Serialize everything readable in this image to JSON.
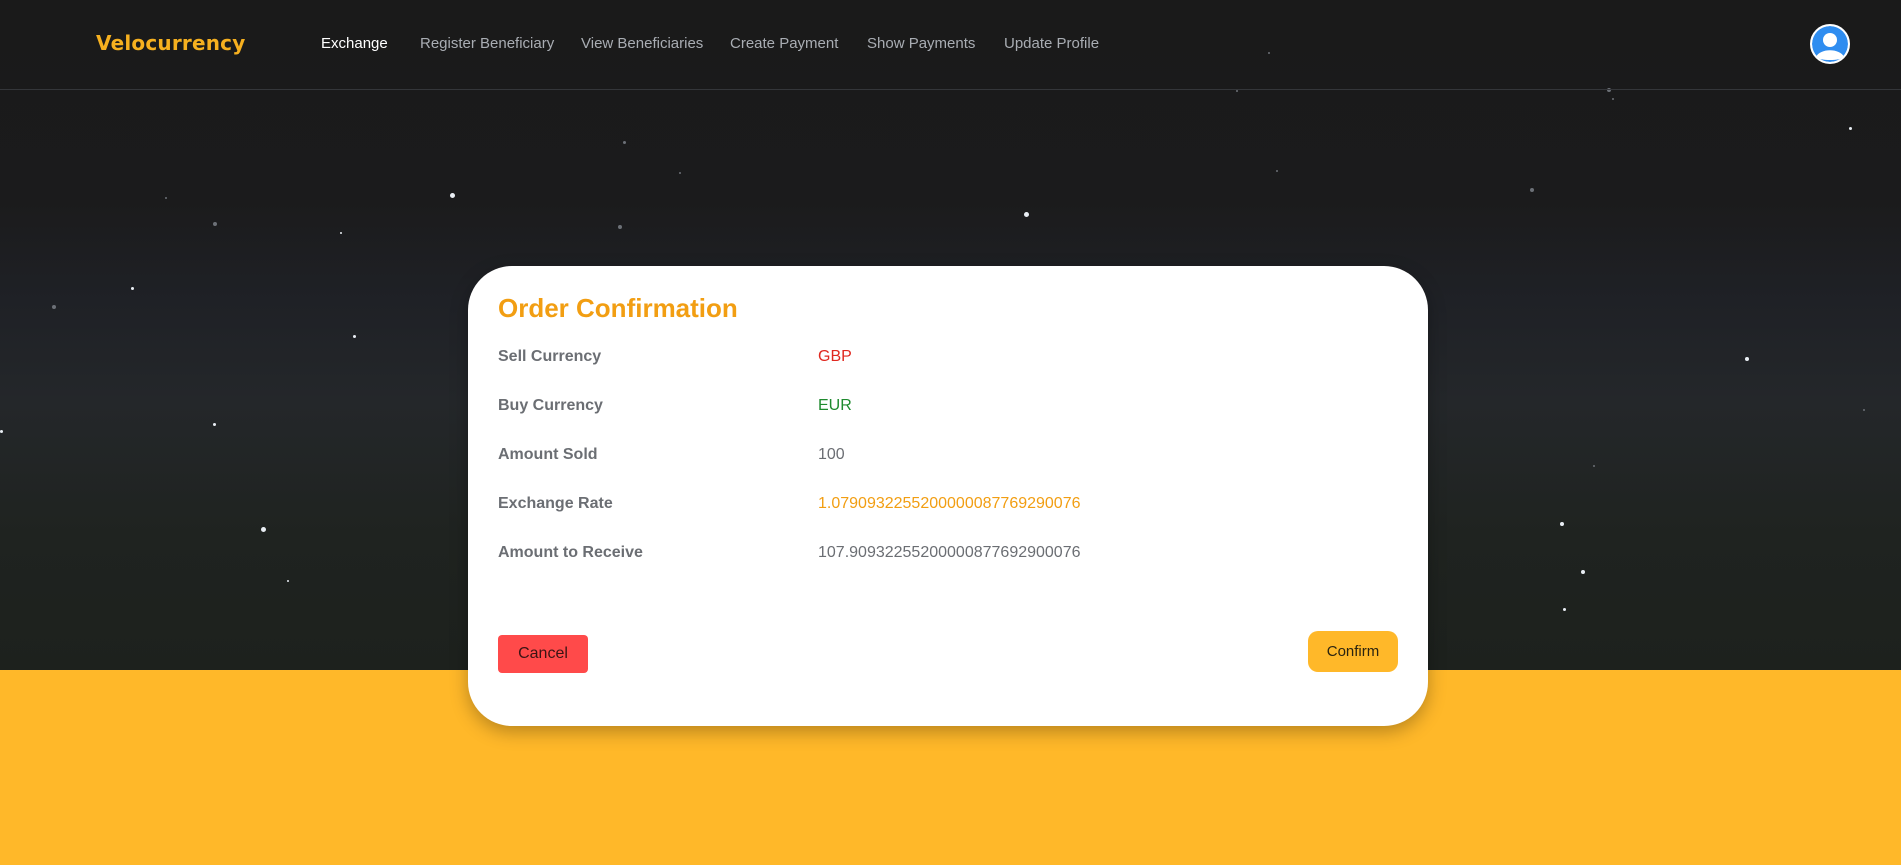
{
  "brand": "Velocurrency",
  "nav": {
    "exchange": "Exchange",
    "register_beneficiary": "Register Beneficiary",
    "view_beneficiaries": "View Beneficiaries",
    "create_payment": "Create Payment",
    "show_payments": "Show Payments",
    "update_profile": "Update Profile",
    "active": "Exchange"
  },
  "profile_icon": "user-avatar-icon",
  "order": {
    "title": "Order Confirmation",
    "rows": [
      {
        "label": "Sell Currency",
        "value": "GBP",
        "color": "#e0281f"
      },
      {
        "label": "Buy Currency",
        "value": "EUR",
        "color": "#1e8a2e"
      },
      {
        "label": "Amount Sold",
        "value": "100",
        "color": "#6b6e73"
      },
      {
        "label": "Exchange Rate",
        "value": "1.0790932255200000087769290076",
        "color": "#f29e12"
      },
      {
        "label": "Amount to Receive",
        "value": "107.90932255200000877692900076",
        "color": "#6b6e73"
      }
    ],
    "cancel_label": "Cancel",
    "confirm_label": "Confirm"
  },
  "colors": {
    "accent": "#f6b01f",
    "background_dark": "#1a1a1a",
    "background_band": "#ffb829",
    "cancel": "#ff4a4a"
  }
}
